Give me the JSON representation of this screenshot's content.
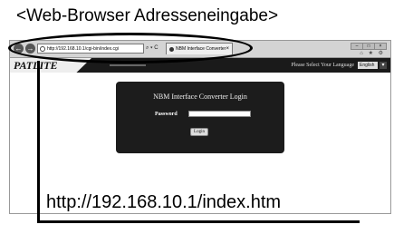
{
  "heading": "<Web-Browser Adresseneingabe>",
  "browser": {
    "address_url": "http://192.168.10.1/cgi-bin/index.cgi",
    "address_tools": "⌕ ▾ C",
    "tab_title": "NBM Interface Converter",
    "tab_close": "×",
    "nav_back": "←",
    "nav_forward": "→",
    "window_buttons": [
      "–",
      "□",
      "×"
    ],
    "window_tools": "⌂ ★ ⚙"
  },
  "site": {
    "logo": "PATLITE",
    "language_prompt": "Please Select Your Language",
    "language_value": "English",
    "language_arrow": "▾"
  },
  "login": {
    "title": "NBM Interface Converter Login",
    "password_label": "Password",
    "password_value": "",
    "button_label": "Login"
  },
  "caption_url": "http://192.168.10.1/index.htm"
}
